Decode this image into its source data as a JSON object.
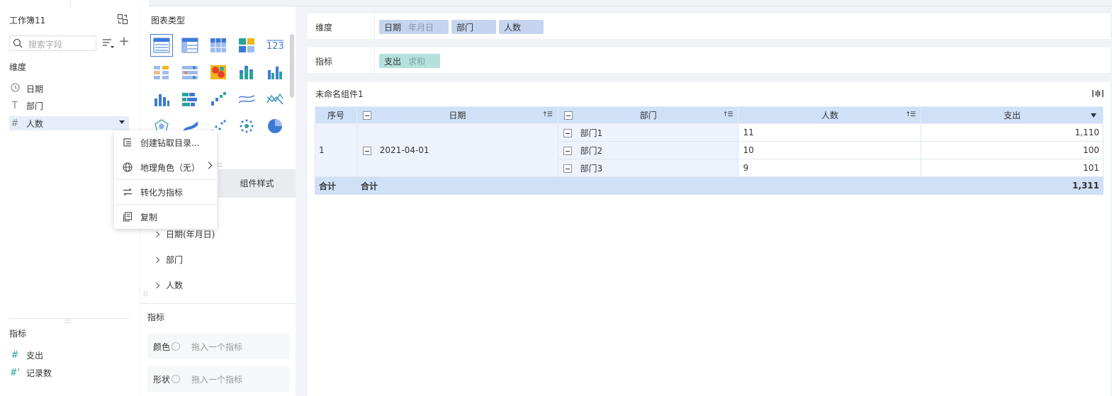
{
  "workbook": {
    "title": "工作簿11"
  },
  "search": {
    "placeholder": "搜索字段"
  },
  "dimensions": {
    "label": "维度",
    "fields": [
      {
        "label": "日期",
        "icon": "clock-icon"
      },
      {
        "label": "部门",
        "icon": "text-type-icon"
      },
      {
        "label": "人数",
        "icon": "hash-icon"
      }
    ]
  },
  "measures": {
    "label": "指标",
    "fields": [
      {
        "label": "支出",
        "icon": "hash-icon"
      },
      {
        "label": "记录数",
        "icon": "hash-calc-icon"
      }
    ]
  },
  "context_menu": {
    "items": [
      {
        "label": "创建钻取目录...",
        "icon": "drill-icon"
      },
      {
        "label": "地理角色（无）",
        "icon": "globe-icon"
      },
      {
        "label": "转化为指标",
        "icon": "swap-icon"
      },
      {
        "label": "复制",
        "icon": "copy-icon"
      }
    ]
  },
  "chart_types": {
    "title": "图表类型"
  },
  "config_tabs": {
    "tab1": "",
    "tab2": "组件样式"
  },
  "tree": {
    "items": [
      "日期(年月日)",
      "部门",
      "人数"
    ]
  },
  "metric_section": {
    "label": "指标",
    "rows": [
      {
        "name": "颜色",
        "placeholder": "拖入一个指标"
      },
      {
        "name": "形状",
        "placeholder": "拖入一个指标"
      }
    ]
  },
  "dim_bar": {
    "label": "维度",
    "pills": [
      {
        "name": "日期",
        "sub": "年月日"
      },
      {
        "name": "部门",
        "sub": ""
      },
      {
        "name": "人数",
        "sub": ""
      }
    ]
  },
  "metric_bar": {
    "label": "指标",
    "pills": [
      {
        "name": "支出",
        "sub": "求和"
      }
    ]
  },
  "component": {
    "title": "未命名组件1"
  },
  "table": {
    "headers": [
      "序号",
      "日期",
      "部门",
      "人数",
      "支出"
    ],
    "group": {
      "index": "1",
      "date": "2021-04-01"
    },
    "rows": [
      {
        "dept": "部门1",
        "count": "11",
        "spend": "1,110"
      },
      {
        "dept": "部门2",
        "count": "10",
        "spend": "100"
      },
      {
        "dept": "部门3",
        "count": "9",
        "spend": "101"
      }
    ],
    "total": {
      "label1": "合计",
      "label2": "合计",
      "spend": "1,311"
    }
  }
}
